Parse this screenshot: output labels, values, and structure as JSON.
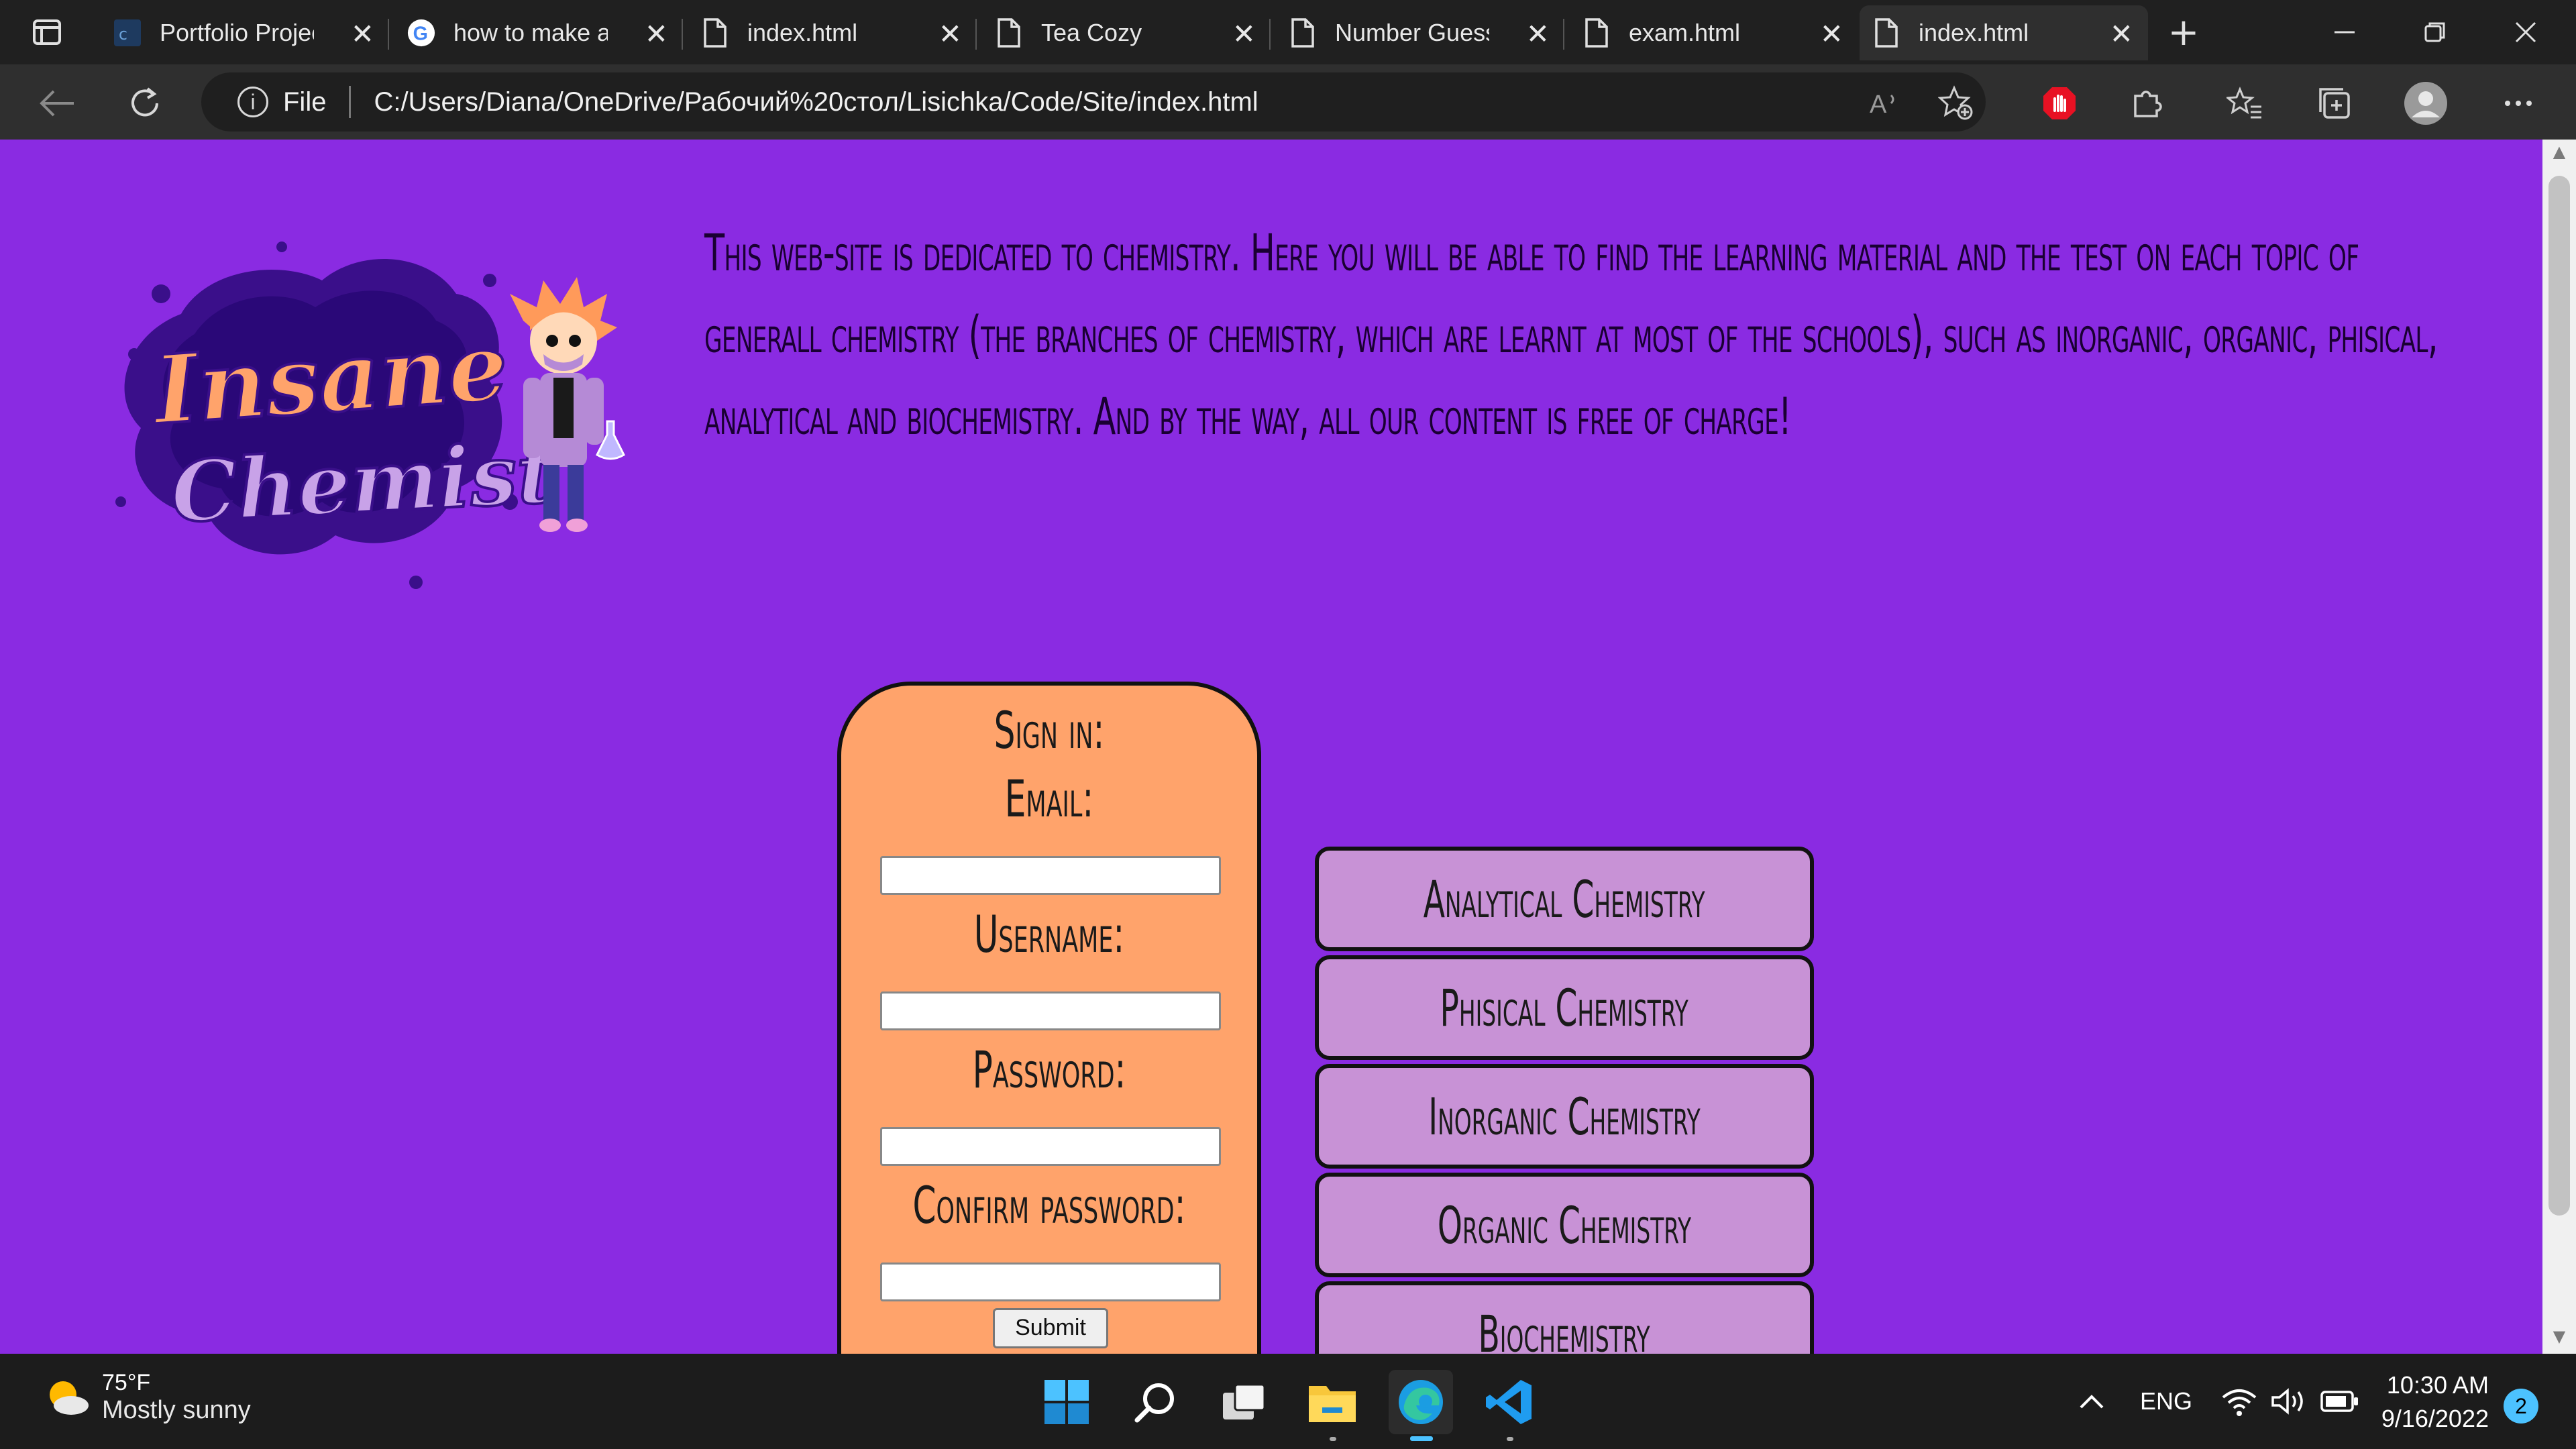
{
  "browser": {
    "tabs": [
      {
        "label": "Portfolio Projec",
        "icon": "code-icon"
      },
      {
        "label": "how to make a",
        "icon": "google-icon"
      },
      {
        "label": "index.html",
        "icon": "file-icon"
      },
      {
        "label": "Tea Cozy",
        "icon": "file-icon"
      },
      {
        "label": "Number Guess",
        "icon": "file-icon"
      },
      {
        "label": "exam.html",
        "icon": "file-icon"
      },
      {
        "label": "index.html",
        "icon": "file-icon",
        "active": true
      }
    ],
    "new_tab": "+",
    "address": {
      "scheme_label": "File",
      "url": "C:/Users/Diana/OneDrive/Рабочий%20стол/Lisichka/Code/Site/index.html"
    }
  },
  "site": {
    "logo": {
      "line1": "Insane",
      "line2": "Chemist"
    },
    "intro": "This web-site is dedicated to chemistry. Here you will be able to find the learning material and the test on each topic of generall chemistry (the branches of chemistry, which are learnt at most of the schools), such as inorganic, organic, phisical, analytical and biochemistry. And by the way, all our content is free of charge!",
    "signin": {
      "title": "Sign in:",
      "email_label": "Email:",
      "username_label": "Username:",
      "password_label": "Password:",
      "confirm_label": "Confirm password:",
      "submit_label": "Submit"
    },
    "topics": [
      "Analytical Chemistry",
      "Phisical Chemistry",
      "Inorganic Chemistry",
      "Organic Chemistry",
      "Biochemistry"
    ]
  },
  "taskbar": {
    "weather": {
      "temp": "75°F",
      "condition": "Mostly sunny"
    },
    "language": "ENG",
    "time": "10:30 AM",
    "date": "9/16/2022",
    "notifications": "2"
  },
  "colors": {
    "page_bg": "#8a2be2",
    "signin_bg": "#ffa36b",
    "topic_bg": "#c892d6"
  }
}
